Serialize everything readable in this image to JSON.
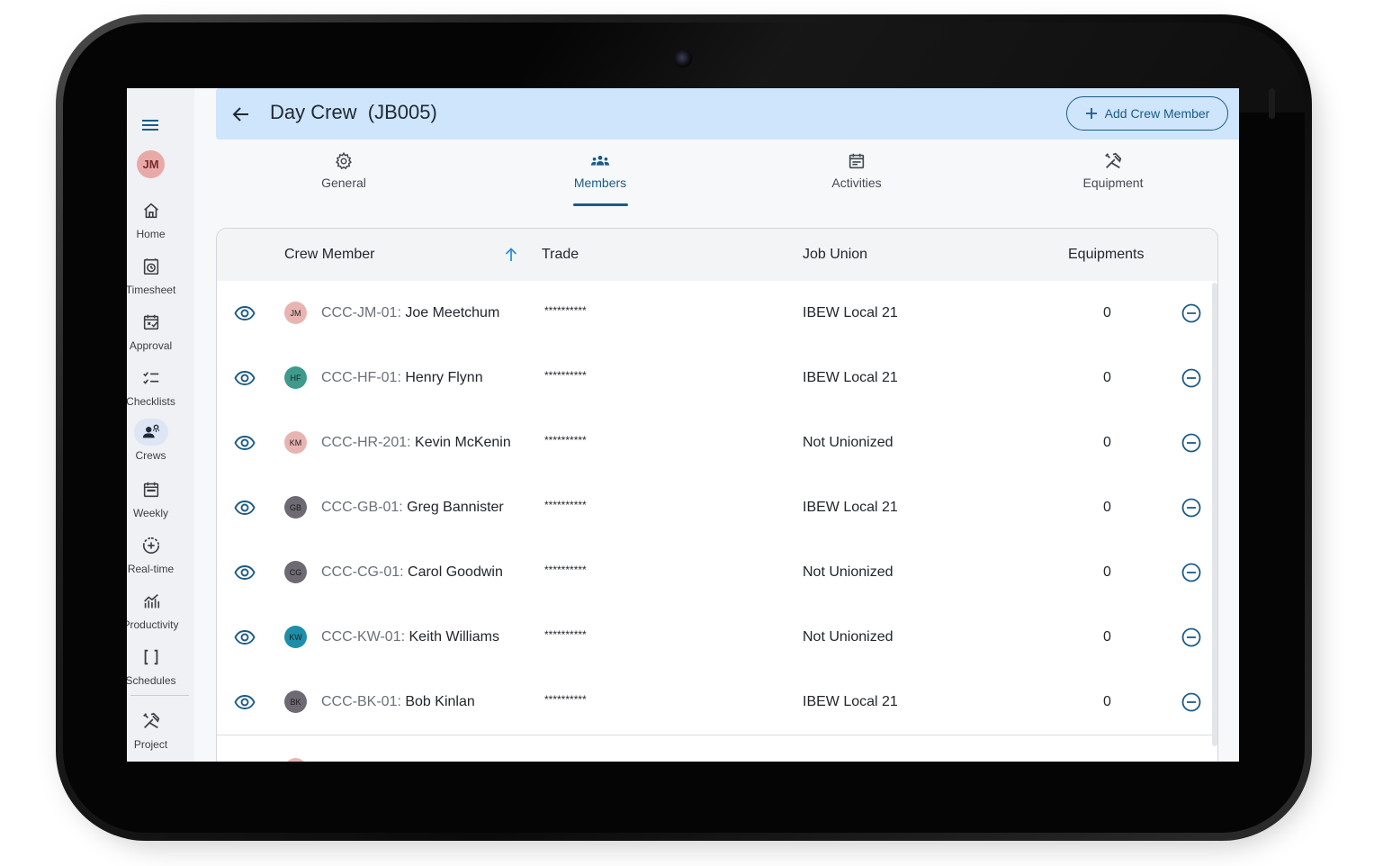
{
  "user": {
    "initials": "JM",
    "avatar_color": "#e8a9a9"
  },
  "sidebar": {
    "items": [
      {
        "label": "Home",
        "icon": "home-icon"
      },
      {
        "label": "Timesheet",
        "icon": "timer-icon"
      },
      {
        "label": "Approval",
        "icon": "calendar-approval-icon"
      },
      {
        "label": "Checklists",
        "icon": "checklist-icon"
      },
      {
        "label": "Crews",
        "icon": "crews-icon",
        "active": true
      },
      {
        "label": "Weekly",
        "icon": "calendar-week-icon"
      },
      {
        "label": "Real-time",
        "icon": "realtime-icon"
      },
      {
        "label": "Productivity",
        "icon": "chart-icon"
      },
      {
        "label": "Schedules",
        "icon": "brackets-icon"
      },
      {
        "label": "Project",
        "icon": "tools-icon"
      }
    ]
  },
  "header": {
    "title": "Day Crew  (JB005)",
    "add_button_label": "Add Crew Member"
  },
  "tabs": [
    {
      "label": "General",
      "icon": "gear-icon"
    },
    {
      "label": "Members",
      "icon": "group-icon",
      "active": true
    },
    {
      "label": "Activities",
      "icon": "calendar-icon"
    },
    {
      "label": "Equipment",
      "icon": "tools-icon"
    }
  ],
  "table": {
    "columns": [
      "Crew Member",
      "Trade",
      "Job Union",
      "Equipments"
    ],
    "sort": {
      "column": "Crew Member",
      "direction": "ascending"
    },
    "rows": [
      {
        "initials": "JM",
        "avatar_color": "#e8b4b1",
        "code": "CCC-JM-01:",
        "name": "Joe Meetchum",
        "trade": "**********",
        "union": "IBEW Local 21",
        "equipments": "0"
      },
      {
        "initials": "HF",
        "avatar_color": "#3f9a8c",
        "code": "CCC-HF-01:",
        "name": "Henry Flynn",
        "trade": "**********",
        "union": "IBEW Local 21",
        "equipments": "0"
      },
      {
        "initials": "KM",
        "avatar_color": "#e8b4b1",
        "code": "CCC-HR-201:",
        "name": "Kevin McKenin",
        "trade": "**********",
        "union": "Not Unionized",
        "equipments": "0"
      },
      {
        "initials": "GB",
        "avatar_color": "#6d6a73",
        "code": "CCC-GB-01:",
        "name": "Greg Bannister",
        "trade": "**********",
        "union": "IBEW Local 21",
        "equipments": "0"
      },
      {
        "initials": "CG",
        "avatar_color": "#6d6a73",
        "code": "CCC-CG-01:",
        "name": "Carol Goodwin",
        "trade": "**********",
        "union": "Not Unionized",
        "equipments": "0"
      },
      {
        "initials": "KW",
        "avatar_color": "#1e8fa8",
        "code": "CCC-KW-01:",
        "name": "Keith Williams",
        "trade": "**********",
        "union": "Not Unionized",
        "equipments": "0"
      },
      {
        "initials": "BK",
        "avatar_color": "#6d6a73",
        "code": "CCC-BK-01:",
        "name": "Bob Kinlan",
        "trade": "**********",
        "union": "IBEW Local 21",
        "equipments": "0"
      }
    ]
  },
  "colors": {
    "accent": "#1c5b86",
    "header_bg": "#cfe5fb",
    "sort_arrow": "#2f8fde"
  }
}
